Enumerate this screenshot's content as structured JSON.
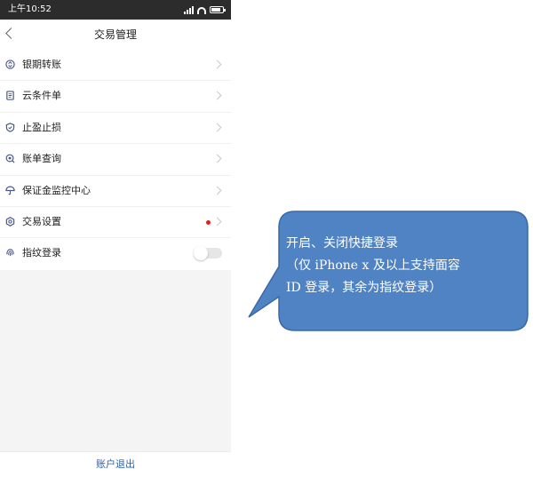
{
  "status_bar": {
    "time": "上午10:52"
  },
  "header": {
    "title": "交易管理"
  },
  "menu": {
    "items": [
      {
        "label": "银期转账",
        "icon": "transfer-icon"
      },
      {
        "label": "云条件单",
        "icon": "document-icon"
      },
      {
        "label": "止盈止损",
        "icon": "shield-icon"
      },
      {
        "label": "账单查询",
        "icon": "search-icon"
      },
      {
        "label": "保证金监控中心",
        "icon": "umbrella-icon"
      },
      {
        "label": "交易设置",
        "icon": "gear-icon",
        "badge": "red-dot"
      },
      {
        "label": "指纹登录",
        "icon": "fingerprint-icon",
        "toggle": "off"
      }
    ]
  },
  "footer": {
    "logout_label": "账户退出"
  },
  "callout": {
    "line1": "开启、关闭快捷登录",
    "line2": "（仅 iPhone x 及以上支持面容",
    "line3": "ID 登录，其余为指纹登录）",
    "fill_color": "#4f83c4",
    "border_color": "#3a6aa6"
  },
  "colors": {
    "status_bar": "#2c2c2c",
    "accent": "#2e5fa8",
    "badge": "#e02020",
    "icon": "#4a5a88"
  }
}
